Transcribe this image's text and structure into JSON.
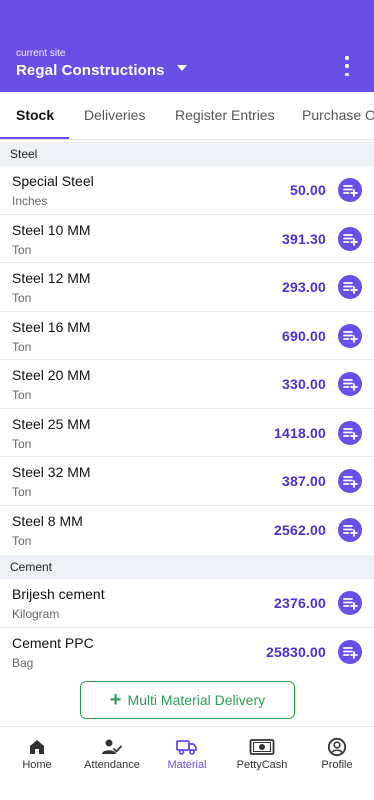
{
  "header": {
    "caption": "current site",
    "site_name": "Regal Constructions",
    "bg_color": "#6a4ee8"
  },
  "tabs": [
    {
      "label": "Stock",
      "active": true
    },
    {
      "label": "Deliveries",
      "active": false
    },
    {
      "label": "Register Entries",
      "active": false
    },
    {
      "label": "Purchase Or",
      "active": false
    }
  ],
  "sections": [
    {
      "title": "Steel",
      "items": [
        {
          "name": "Special Steel",
          "unit": "Inches",
          "qty": "50.00"
        },
        {
          "name": "Steel 10 MM",
          "unit": "Ton",
          "qty": "391.30"
        },
        {
          "name": "Steel 12 MM",
          "unit": "Ton",
          "qty": "293.00"
        },
        {
          "name": "Steel 16 MM",
          "unit": "Ton",
          "qty": "690.00"
        },
        {
          "name": "Steel 20 MM",
          "unit": "Ton",
          "qty": "330.00"
        },
        {
          "name": "Steel 25 MM",
          "unit": "Ton",
          "qty": "1418.00"
        },
        {
          "name": "Steel 32 MM",
          "unit": "Ton",
          "qty": "387.00"
        },
        {
          "name": "Steel 8 MM",
          "unit": "Ton",
          "qty": "2562.00"
        }
      ]
    },
    {
      "title": "Cement",
      "items": [
        {
          "name": "Brijesh cement",
          "unit": "Kilogram",
          "qty": "2376.00"
        },
        {
          "name": "Cement PPC",
          "unit": "Bag",
          "qty": "25830.00"
        }
      ]
    }
  ],
  "multi_delivery": {
    "plus": "+",
    "label": "Multi Material Delivery"
  },
  "bottom_nav": [
    {
      "label": "Home",
      "icon": "home-icon",
      "active": false
    },
    {
      "label": "Attendance",
      "icon": "attendance-icon",
      "active": false
    },
    {
      "label": "Material",
      "icon": "truck-icon",
      "active": true
    },
    {
      "label": "PettyCash",
      "icon": "cash-icon",
      "active": false
    },
    {
      "label": "Profile",
      "icon": "profile-icon",
      "active": false
    }
  ],
  "colors": {
    "accent": "#6a4ee8",
    "quantity": "#4d2fd3",
    "success": "#2f9d55"
  }
}
